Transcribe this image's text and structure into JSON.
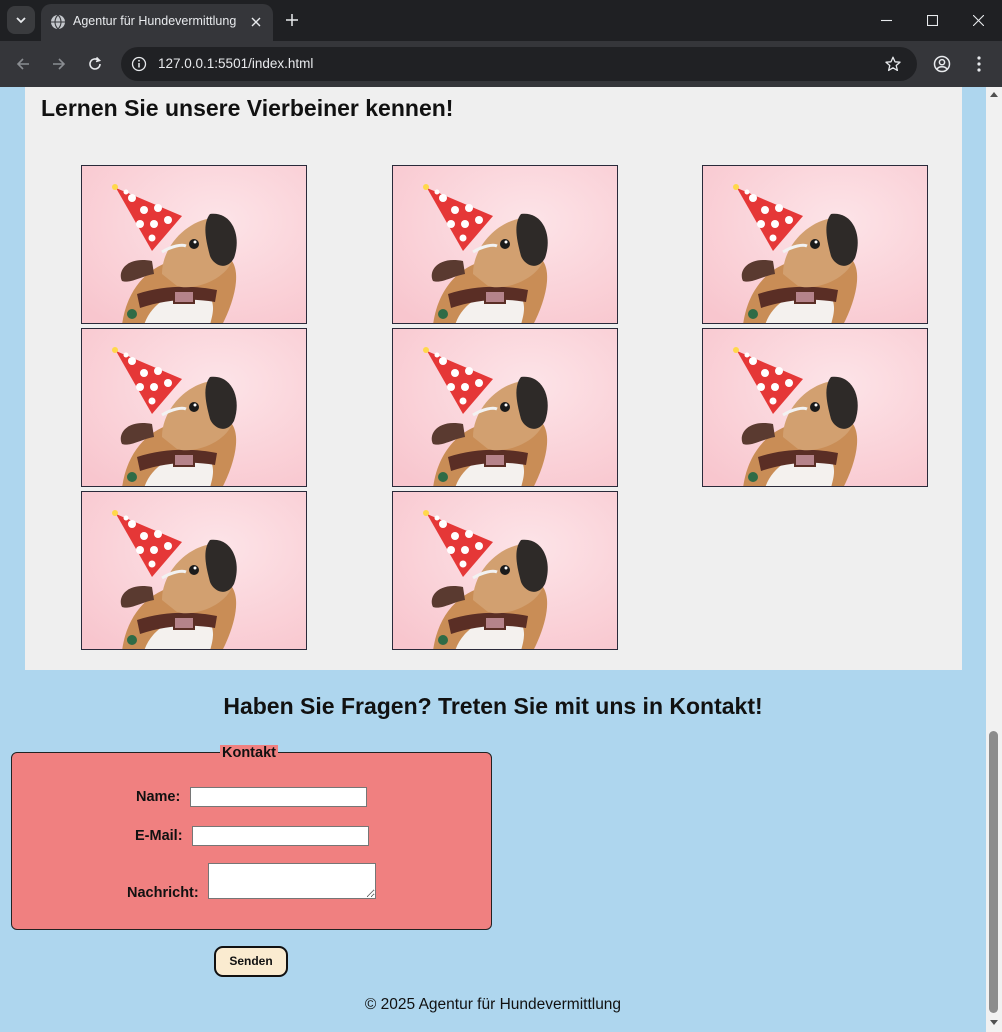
{
  "browser": {
    "tab_title": "Agentur für Hundevermittlung",
    "url": "127.0.0.1:5501/index.html",
    "icons": {
      "tab_menu": "chevron-down-icon",
      "favicon": "globe-icon",
      "tab_close": "close-icon",
      "new_tab": "plus-icon",
      "minimize": "minimize-icon",
      "maximize": "maximize-icon",
      "close_window": "close-icon",
      "back": "arrow-left-icon",
      "forward": "arrow-right-icon",
      "reload": "reload-icon",
      "site_info": "info-icon",
      "bookmark": "star-icon",
      "profile": "account-icon",
      "menu": "kebab-menu-icon"
    }
  },
  "gallery": {
    "title": "Lernen Sie unsere Vierbeiner kennen!",
    "image_count": 8,
    "image_subject": "dog-with-party-hat"
  },
  "contact": {
    "title": "Haben Sie Fragen? Treten Sie mit uns in Kontakt!",
    "legend": "Kontakt",
    "name_label": "Name:",
    "name_value": "",
    "email_label": "E-Mail:",
    "email_value": "",
    "message_label": "Nachricht:",
    "message_value": "",
    "submit_label": "Senden"
  },
  "footer": {
    "text": "© 2025 Agentur für Hundevermittlung"
  },
  "colors": {
    "page_background": "#aed6ee",
    "gallery_background": "#efefef",
    "form_background": "#f08080",
    "button_background": "#faebd0"
  }
}
